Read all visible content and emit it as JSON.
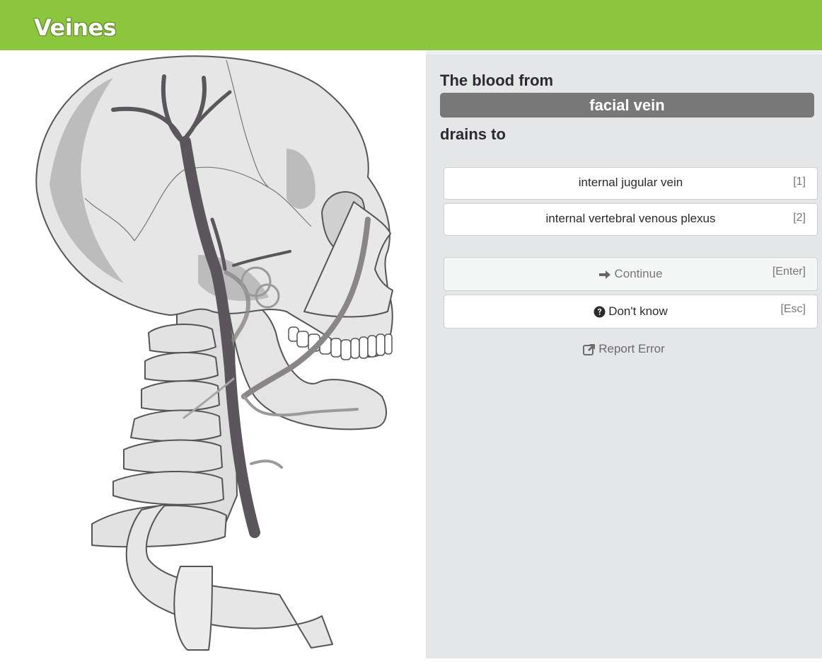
{
  "app": {
    "title": "Veines"
  },
  "question": {
    "prefix": "The blood from",
    "term": "facial vein",
    "suffix": "drains to"
  },
  "answers": [
    {
      "label": "internal jugular vein",
      "key": "[1]"
    },
    {
      "label": "internal vertebral venous plexus",
      "key": "[2]"
    }
  ],
  "actions": {
    "continue": {
      "label": "Continue",
      "key": "[Enter]",
      "icon": "arrow-right-icon"
    },
    "dont_know": {
      "label": "Don't know",
      "key": "[Esc]",
      "icon": "question-circle-icon"
    },
    "report": {
      "label": "Report Error",
      "icon": "external-link-icon"
    }
  },
  "colors": {
    "header": "#8cc63f",
    "panel": "#e5e6e7",
    "term_badge": "#787878",
    "vein_dark": "#5a565c",
    "vein_muted": "#8a8686"
  }
}
